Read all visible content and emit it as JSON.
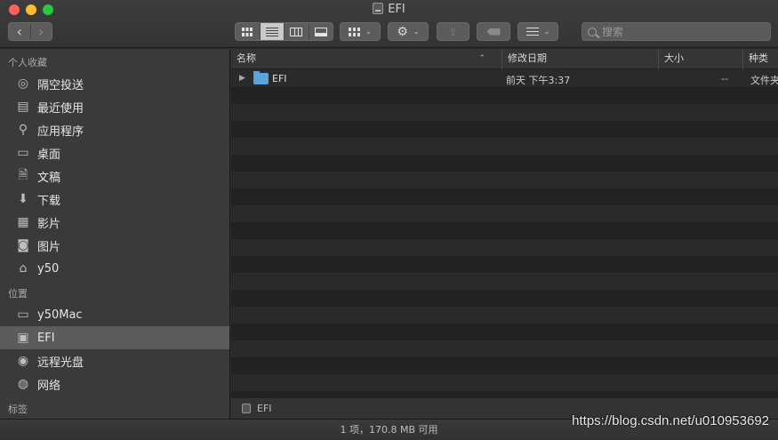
{
  "window": {
    "title": "EFI"
  },
  "toolbar": {
    "back": "‹",
    "forward": "›",
    "action_symbol": "⚙",
    "share_symbol": "⇪",
    "chevron": "⌄",
    "search_placeholder": "搜索",
    "active_view": "list"
  },
  "sidebar": {
    "favorites_header": "个人收藏",
    "favorites": [
      {
        "label": "隔空投送",
        "icon": "airdrop-icon",
        "glyph": "◎"
      },
      {
        "label": "最近使用",
        "icon": "recents-icon",
        "glyph": "▤"
      },
      {
        "label": "应用程序",
        "icon": "applications-icon",
        "glyph": "⚲"
      },
      {
        "label": "桌面",
        "icon": "desktop-icon",
        "glyph": "▭"
      },
      {
        "label": "文稿",
        "icon": "documents-icon",
        "glyph": "🗎"
      },
      {
        "label": "下载",
        "icon": "downloads-icon",
        "glyph": "⬇"
      },
      {
        "label": "影片",
        "icon": "movies-icon",
        "glyph": "▦"
      },
      {
        "label": "图片",
        "icon": "pictures-icon",
        "glyph": "◙"
      },
      {
        "label": "y50",
        "icon": "home-icon",
        "glyph": "⌂"
      }
    ],
    "locations_header": "位置",
    "locations": [
      {
        "label": "y50Mac",
        "icon": "laptop-icon",
        "glyph": "▭",
        "selected": false
      },
      {
        "label": "EFI",
        "icon": "disk-icon",
        "glyph": "▣",
        "selected": true
      },
      {
        "label": "远程光盘",
        "icon": "remote-disc-icon",
        "glyph": "◉",
        "selected": false
      },
      {
        "label": "网络",
        "icon": "network-icon",
        "glyph": "◍",
        "selected": false
      }
    ],
    "tags_header": "标签"
  },
  "list": {
    "columns": {
      "name": "名称",
      "date": "修改日期",
      "size": "大小",
      "kind": "种类"
    },
    "sort_indicator": "⌃",
    "rows": [
      {
        "name": "EFI",
        "date": "前天 下午3:37",
        "size": "--",
        "kind": "文件夹",
        "disclosure": "▶"
      }
    ]
  },
  "pathbar": {
    "item": "EFI"
  },
  "status": {
    "text": "1 项，170.8 MB 可用"
  },
  "watermark": "https://blog.csdn.net/u010953692"
}
